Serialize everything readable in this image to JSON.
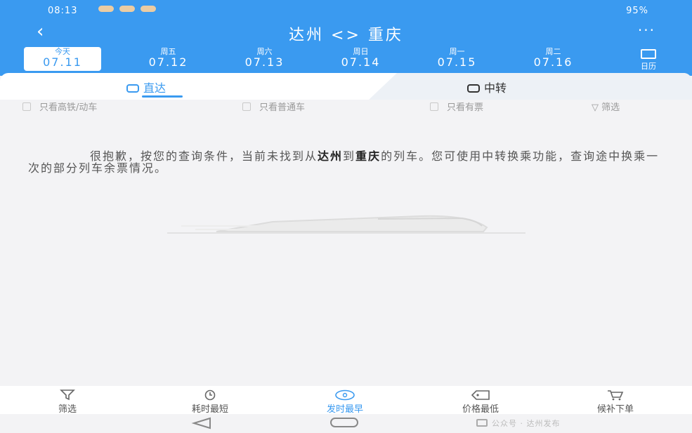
{
  "status_bar": {
    "time": "08:13",
    "battery": "95%"
  },
  "nav": {
    "title": "达州 <> 重庆",
    "more": "···"
  },
  "dates": [
    {
      "weekday": "今天",
      "date": "07.11",
      "selected": true
    },
    {
      "weekday": "周五",
      "date": "07.12",
      "selected": false
    },
    {
      "weekday": "周六",
      "date": "07.13",
      "selected": false
    },
    {
      "weekday": "周日",
      "date": "07.14",
      "selected": false
    },
    {
      "weekday": "周一",
      "date": "07.15",
      "selected": false
    },
    {
      "weekday": "周二",
      "date": "07.16",
      "selected": false
    }
  ],
  "calendar_label": "日历",
  "tabs": {
    "direct": "直达",
    "transfer": "中转"
  },
  "filters": {
    "high_speed": "只看高铁/动车",
    "normal": "只看普通车",
    "has_ticket": "只看有票",
    "filter": "筛选"
  },
  "message": {
    "part1": "很抱歉，按您的查询条件，当前未找到从",
    "from": "达州",
    "part2": "到",
    "to": "重庆",
    "part3": "的列车。您可使用中转换乘功能，查询途中换乘一次的部分列车余票情况。"
  },
  "bottom_bar": {
    "filter": "筛选",
    "shortest": "耗时最短",
    "earliest": "发时最早",
    "lowest_price": "价格最低",
    "order": "候补下单"
  },
  "watermark": "公众号 · 达州发布",
  "colors": {
    "primary": "#3a9af0",
    "background": "#f3f3f5"
  }
}
